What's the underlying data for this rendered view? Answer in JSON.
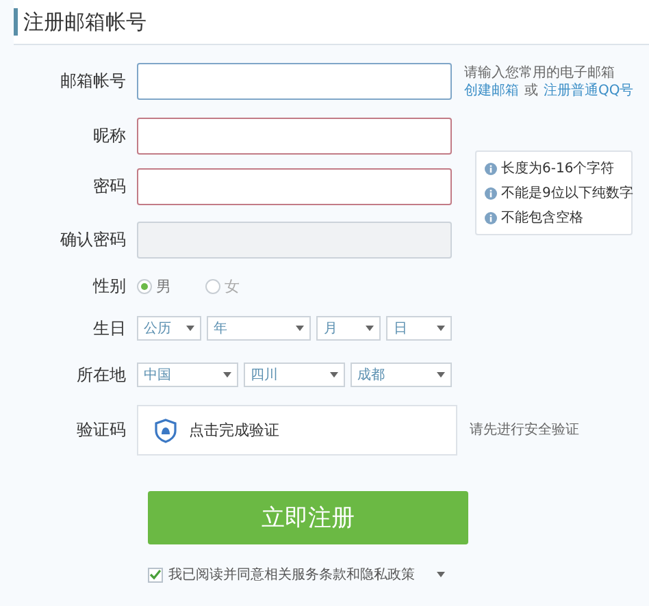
{
  "title": "注册邮箱帐号",
  "fields": [
    {
      "label": "邮箱帐号",
      "error": false,
      "disabled": false,
      "focused": true
    },
    {
      "label": "昵称",
      "error": true,
      "disabled": false,
      "focused": false
    },
    {
      "label": "密码",
      "error": true,
      "disabled": false,
      "focused": false
    },
    {
      "label": "确认密码",
      "error": false,
      "disabled": true,
      "focused": false
    }
  ],
  "email_hint": {
    "text": "请输入您常用的电子邮箱",
    "links": [
      "创建邮箱",
      "注册普通QQ号"
    ],
    "separator": "或"
  },
  "password_rules": [
    "长度为6-16个字符",
    "不能是9位以下纯数字",
    "不能包含空格"
  ],
  "gender": {
    "label": "性别",
    "options": [
      {
        "label": "男",
        "selected": true
      },
      {
        "label": "女",
        "selected": false
      }
    ]
  },
  "birthday": {
    "label": "生日",
    "selects": [
      "公历",
      "年",
      "月",
      "日"
    ]
  },
  "location": {
    "label": "所在地",
    "selects": [
      "中国",
      "四川",
      "成都"
    ]
  },
  "captcha": {
    "label": "验证码",
    "button": "点击完成验证",
    "hint": "请先进行安全验证"
  },
  "submit": "立即注册",
  "agreement": {
    "text": "我已阅读并同意相关服务条款和隐私政策",
    "checked": true
  }
}
